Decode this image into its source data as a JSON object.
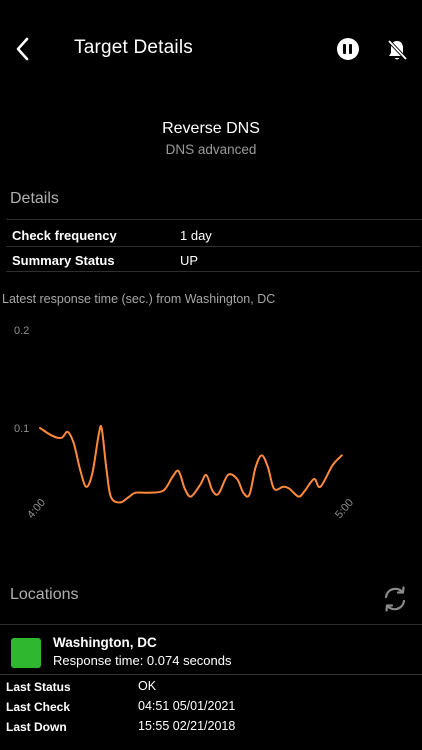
{
  "header": {
    "title": "Target Details",
    "back_icon": "chevron-left-icon",
    "pause_icon": "pause-circle-icon",
    "notifications_icon": "bell-off-icon"
  },
  "target": {
    "name": "Reverse DNS",
    "type": "DNS advanced"
  },
  "details": {
    "section_title": "Details",
    "rows": [
      {
        "label": "Check frequency",
        "value": "1 day"
      },
      {
        "label": "Summary Status",
        "value": "UP"
      }
    ]
  },
  "chart": {
    "caption": "Latest response time (sec.) from Washington, DC",
    "line_color": "#ff8a3c",
    "chart_data": {
      "type": "line",
      "title": "",
      "xlabel": "",
      "ylabel": "",
      "y_ticks": [
        "0.2",
        "0.1"
      ],
      "x_ticks": [
        "4:00",
        "5:00"
      ],
      "ylim": [
        0.0,
        0.2
      ],
      "xlim": [
        0,
        1
      ],
      "grid": false,
      "series": [
        {
          "values": [
            [
              0.0,
              0.1
            ],
            [
              0.04,
              0.092
            ],
            [
              0.07,
              0.09
            ],
            [
              0.09,
              0.096
            ],
            [
              0.11,
              0.084
            ],
            [
              0.13,
              0.058
            ],
            [
              0.15,
              0.04
            ],
            [
              0.17,
              0.054
            ],
            [
              0.19,
              0.092
            ],
            [
              0.2,
              0.1
            ],
            [
              0.215,
              0.06
            ],
            [
              0.23,
              0.03
            ],
            [
              0.26,
              0.024
            ],
            [
              0.29,
              0.03
            ],
            [
              0.31,
              0.034
            ],
            [
              0.35,
              0.034
            ],
            [
              0.4,
              0.036
            ],
            [
              0.43,
              0.05
            ],
            [
              0.45,
              0.056
            ],
            [
              0.47,
              0.038
            ],
            [
              0.49,
              0.03
            ],
            [
              0.52,
              0.042
            ],
            [
              0.54,
              0.052
            ],
            [
              0.56,
              0.036
            ],
            [
              0.58,
              0.033
            ],
            [
              0.61,
              0.052
            ],
            [
              0.64,
              0.048
            ],
            [
              0.66,
              0.034
            ],
            [
              0.68,
              0.032
            ],
            [
              0.7,
              0.06
            ],
            [
              0.72,
              0.072
            ],
            [
              0.74,
              0.06
            ],
            [
              0.76,
              0.038
            ],
            [
              0.79,
              0.04
            ],
            [
              0.81,
              0.038
            ],
            [
              0.84,
              0.03
            ],
            [
              0.86,
              0.036
            ],
            [
              0.89,
              0.048
            ],
            [
              0.91,
              0.04
            ],
            [
              0.95,
              0.062
            ],
            [
              0.98,
              0.072
            ]
          ]
        }
      ]
    }
  },
  "locations": {
    "section_title": "Locations",
    "refresh_icon": "refresh-icon",
    "status_color": "#2fb82f",
    "items": [
      {
        "name": "Washington, DC",
        "response": "Response time: 0.074 seconds"
      }
    ],
    "stats": [
      {
        "label": "Last Status",
        "value": "OK"
      },
      {
        "label": "Last Check",
        "value": "04:51 05/01/2021"
      },
      {
        "label": "Last Down",
        "value": "15:55 02/21/2018"
      }
    ]
  }
}
